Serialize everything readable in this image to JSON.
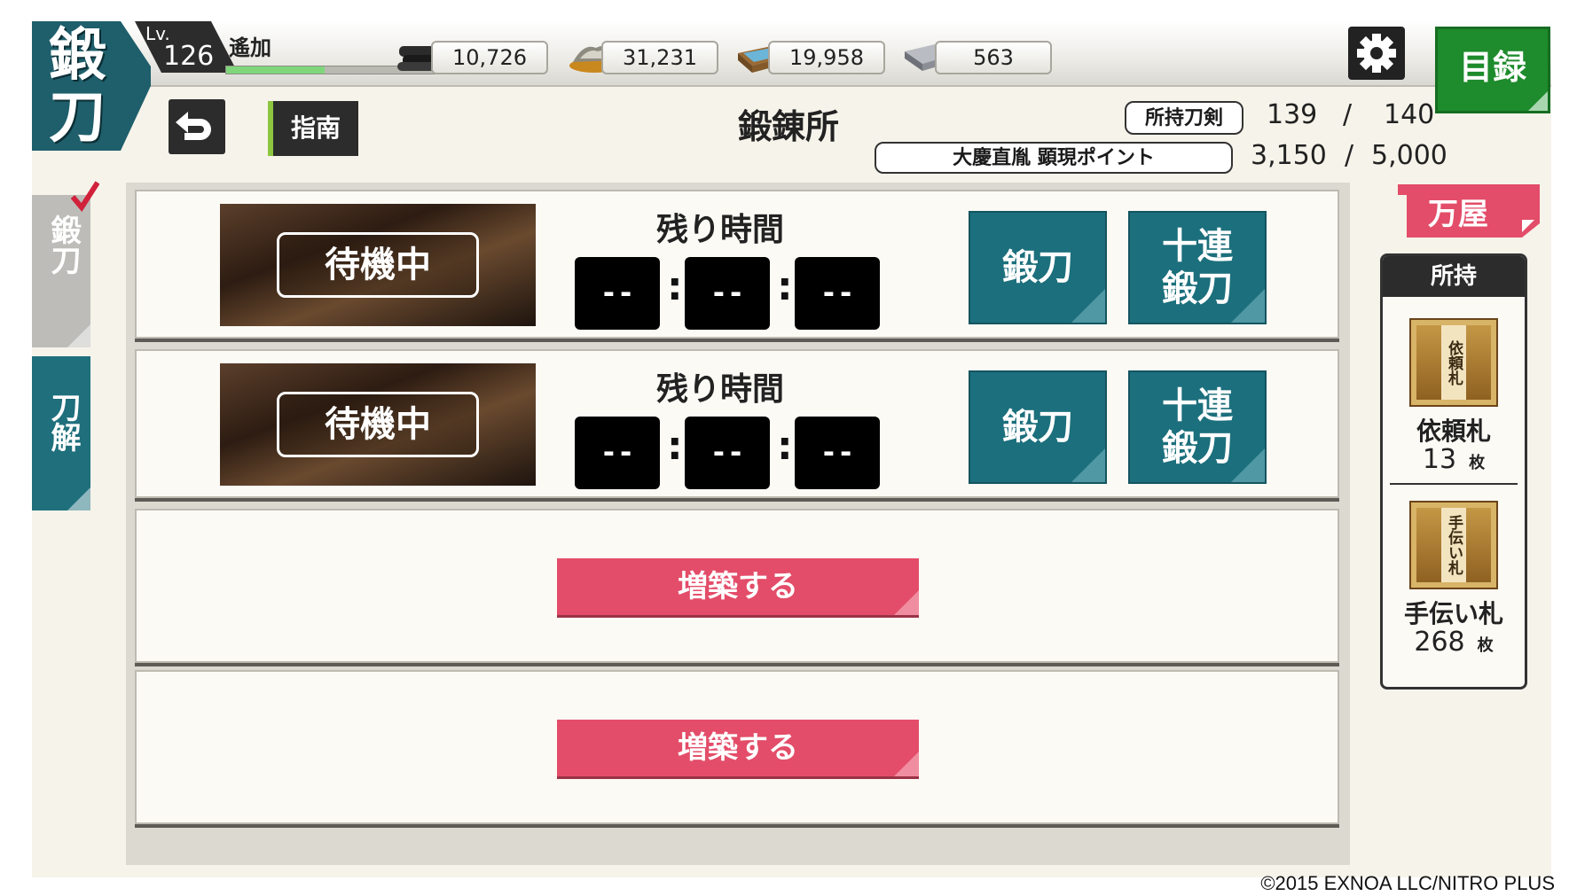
{
  "header": {
    "emblem": "鍛刀",
    "level_label": "Lv.",
    "level": "126",
    "player_name": "遙加",
    "xp_fraction": 0.47,
    "resources": [
      {
        "icon": "charcoal-icon",
        "value": "10,726"
      },
      {
        "icon": "jewel-steel-icon",
        "value": "31,231"
      },
      {
        "icon": "cooling-water-icon",
        "value": "19,958"
      },
      {
        "icon": "whetstone-icon",
        "value": "563"
      }
    ],
    "settings_icon": "gear-icon",
    "menu_button": "目録"
  },
  "subheader": {
    "back_icon": "back-arrow-icon",
    "guide_button": "指南",
    "page_title": "鍛錬所",
    "owned_swords_label": "所持刀剣",
    "owned_swords_value": "139",
    "owned_swords_sep": "/",
    "owned_swords_max": "140",
    "event_points_label": "大慶直胤 顕現ポイント",
    "event_points_value": "3,150",
    "event_points_sep": "/",
    "event_points_max": "5,000"
  },
  "side_tabs": [
    {
      "label": "鍛刀",
      "active": true
    },
    {
      "label": "刀解",
      "active": false
    }
  ],
  "forge_slots": [
    {
      "status": "待機中",
      "timer_label": "残り時間",
      "hours": "--",
      "minutes": "--",
      "seconds": "--",
      "forge_button": "鍛刀",
      "ten_forge_button": "十連\n鍛刀"
    },
    {
      "status": "待機中",
      "timer_label": "残り時間",
      "hours": "--",
      "minutes": "--",
      "seconds": "--",
      "forge_button": "鍛刀",
      "ten_forge_button": "十連\n鍛刀"
    }
  ],
  "locked_slots": [
    {
      "expand_button": "増築する"
    },
    {
      "expand_button": "増築する"
    }
  ],
  "shop": {
    "button": "万屋",
    "owned_heading": "所持",
    "items": [
      {
        "icon_text": "依頼札",
        "name": "依頼札",
        "count": "13",
        "unit": "枚"
      },
      {
        "icon_text": "手伝い札",
        "name": "手伝い札",
        "count": "268",
        "unit": "枚"
      }
    ]
  },
  "copyright": "©2015 EXNOA LLC/NITRO PLUS",
  "colors": {
    "teal": "#1c6f7c",
    "pink": "#e34d69",
    "green": "#1e8b2c",
    "xp": "#7fd67b"
  }
}
